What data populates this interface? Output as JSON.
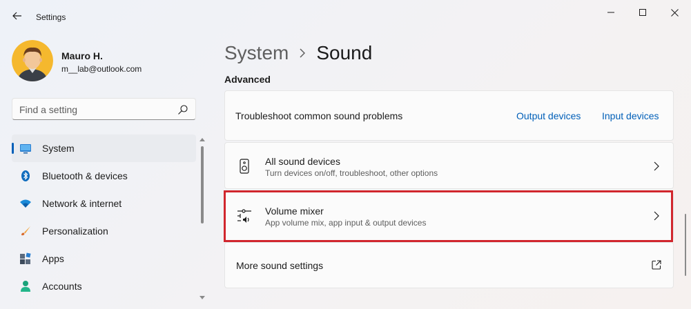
{
  "window": {
    "title": "Settings"
  },
  "user": {
    "name": "Mauro H.",
    "email": "m__lab@outlook.com"
  },
  "search": {
    "placeholder": "Find a setting"
  },
  "sidebar": {
    "items": [
      {
        "label": "System",
        "icon": "monitor-icon",
        "active": true
      },
      {
        "label": "Bluetooth & devices",
        "icon": "bluetooth-icon",
        "active": false
      },
      {
        "label": "Network & internet",
        "icon": "wifi-icon",
        "active": false
      },
      {
        "label": "Personalization",
        "icon": "brush-icon",
        "active": false
      },
      {
        "label": "Apps",
        "icon": "apps-icon",
        "active": false
      },
      {
        "label": "Accounts",
        "icon": "person-icon",
        "active": false
      }
    ]
  },
  "breadcrumb": {
    "parent": "System",
    "current": "Sound"
  },
  "section": {
    "title": "Advanced"
  },
  "troubleshoot": {
    "label": "Troubleshoot common sound problems",
    "output_link": "Output devices",
    "input_link": "Input devices"
  },
  "all_devices": {
    "title": "All sound devices",
    "subtitle": "Turn devices on/off, troubleshoot, other options",
    "icon": "speaker-icon"
  },
  "volume_mixer": {
    "title": "Volume mixer",
    "subtitle": "App volume mix, app input & output devices",
    "icon": "mixer-icon"
  },
  "more_settings": {
    "label": "More sound settings",
    "icon": "external-link-icon"
  },
  "colors": {
    "accent": "#005fb8",
    "highlight": "#d1262d"
  }
}
